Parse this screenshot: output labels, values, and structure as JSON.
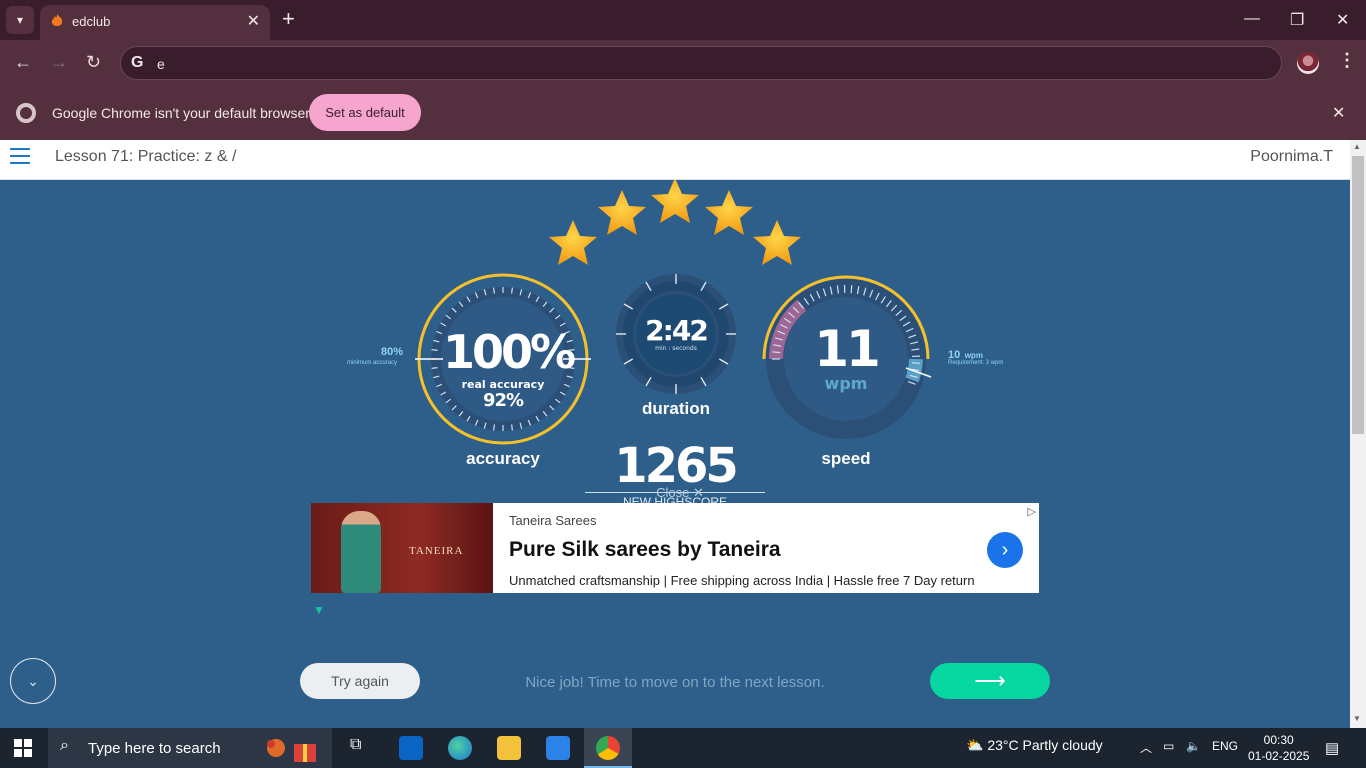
{
  "browser": {
    "tab_title": "edclub",
    "address_text": "e",
    "info_message": "Google Chrome isn't your default browser",
    "set_default_label": "Set as default"
  },
  "page": {
    "lesson_title": "Lesson 71: Practice: z & /",
    "username": "Poornima.T"
  },
  "results": {
    "stars": 5,
    "accuracy": {
      "value": "100%",
      "real_label": "real accuracy",
      "real_value": "92%",
      "caption": "accuracy",
      "min_value": "80%",
      "min_label": "minimum accuracy"
    },
    "duration": {
      "value": "2:42",
      "unit": "min : seconds",
      "caption": "duration"
    },
    "speed": {
      "value": "11",
      "unit": "wpm",
      "caption": "speed",
      "req_value": "10",
      "req_unit": "wpm",
      "req_label": "Requirement: 3 wpm"
    },
    "score": {
      "value": "1265",
      "close_label": "Close ✕",
      "new_highscore": "NEW HIGHSCORE"
    }
  },
  "ad": {
    "source": "Taneira Sarees",
    "headline": "Pure Silk sarees by Taneira",
    "description": "Unmatched craftsmanship | Free shipping across India | Hassle free 7 Day return",
    "image_brand": "TANEIRA"
  },
  "actions": {
    "try_again": "Try again",
    "nice_job": "Nice job! Time to move on to the next lesson."
  },
  "taskbar": {
    "search_placeholder": "Type here to search",
    "temperature": "23°C",
    "weather": "Partly cloudy",
    "language": "ENG",
    "time": "00:30",
    "date": "01-02-2025"
  },
  "colors": {
    "page_bg": "#2e5f8a",
    "gold": "#f5c02a",
    "accent_next": "#06d6a0",
    "speed_pink": "#b06a9a",
    "speed_req": "#5ea7cf"
  }
}
